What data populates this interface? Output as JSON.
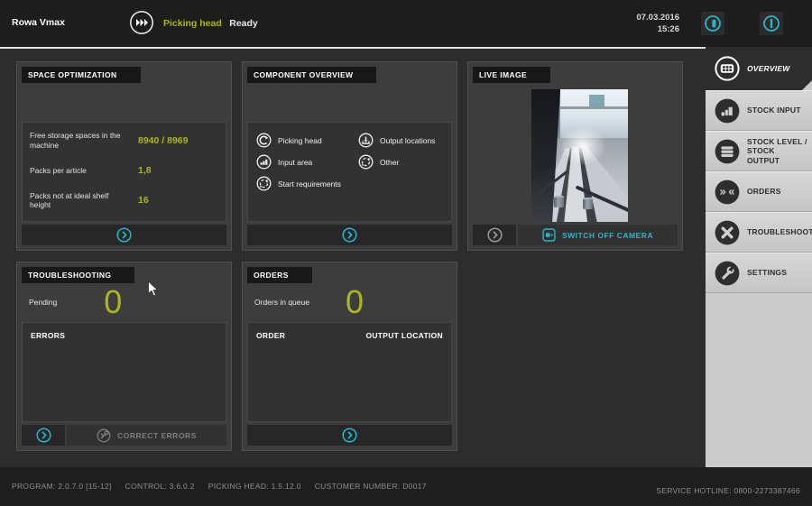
{
  "topbar": {
    "app_title": "Rowa Vmax",
    "status_label": "Picking head",
    "status_value": "Ready",
    "date": "07.03.2016",
    "time": "15:26",
    "buttons": [
      {
        "icon": "standby-screen-icon"
      },
      {
        "icon": "power-icon"
      }
    ]
  },
  "panels": {
    "space_optimization": {
      "title": "SPACE OPTIMIZATION",
      "rows": [
        {
          "label": "Free storage spaces in the machine",
          "value": "8940 / 8969"
        },
        {
          "label": "Packs per article",
          "value": "1,8"
        },
        {
          "label": "Packs not at ideal shelf height",
          "value": "16"
        }
      ]
    },
    "component_overview": {
      "title": "COMPONENT OVERVIEW",
      "items_left": [
        {
          "icon": "picking-head-icon",
          "label": "Picking head"
        },
        {
          "icon": "input-area-icon",
          "label": "Input area"
        },
        {
          "icon": "start-requirements-icon",
          "label": "Start requirements"
        }
      ],
      "items_right": [
        {
          "icon": "output-locations-icon",
          "label": "Output locations"
        },
        {
          "icon": "other-icon",
          "label": "Other"
        }
      ]
    },
    "live_image": {
      "title": "LIVE IMAGE",
      "switch_off_label": "SWITCH OFF CAMERA"
    },
    "troubleshooting": {
      "title": "TROUBLESHOOTING",
      "pending_label": "Pending",
      "pending_value": "0",
      "list_header": "ERRORS",
      "correct_errors_label": "CORRECT ERRORS"
    },
    "orders": {
      "title": "ORDERS",
      "queue_label": "Orders in queue",
      "queue_value": "0",
      "col_order": "ORDER",
      "col_output_location": "OUTPUT LOCATION"
    }
  },
  "sidebar": {
    "items": [
      {
        "icon": "overview-icon",
        "label": "OVERVIEW",
        "active": true
      },
      {
        "icon": "stock-input-icon",
        "label": "STOCK INPUT",
        "active": false
      },
      {
        "icon": "stock-level-icon",
        "label": "STOCK LEVEL / STOCK OUTPUT",
        "active": false
      },
      {
        "icon": "orders-icon",
        "label": "ORDERS",
        "active": false
      },
      {
        "icon": "troubleshooting-icon",
        "label": "TROUBLESHOOTING",
        "active": false
      },
      {
        "icon": "settings-icon",
        "label": "SETTINGS",
        "active": false
      }
    ]
  },
  "statusbar": {
    "program": "PROGRAM: 2.0.7.0 [15-12]",
    "control": "CONTROL: 3.6.0.2",
    "picking_head": "PICKING HEAD: 1.5.12.0",
    "customer_number": "CUSTOMER NUMBER: D0017",
    "service_hotline": "SERVICE HOTLINE: 0800-2273387466"
  },
  "colors": {
    "accent_green": "#aab521",
    "accent_teal": "#2ab5c8",
    "topbar_bg": "#1d1d1d",
    "panel_bg": "#3d3d3d",
    "sidebar_bg": "#cbcbcb"
  }
}
